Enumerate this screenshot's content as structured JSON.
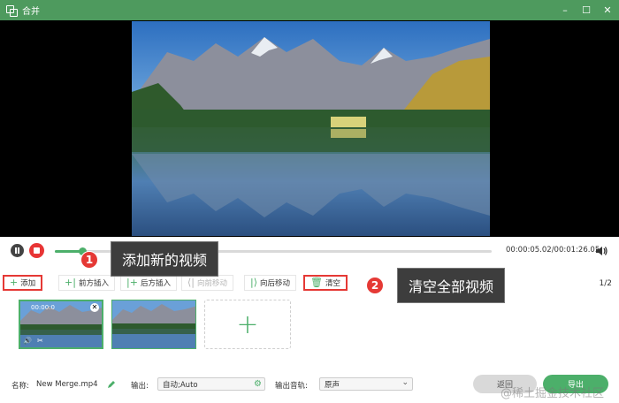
{
  "window": {
    "title": "合并"
  },
  "player": {
    "progress_fraction": 0.063,
    "time_readout": "00:00:05.02/00:01:26.05"
  },
  "toolbar": {
    "add_label": "添加",
    "insert_before_label": "前方插入",
    "insert_after_label": "后方插入",
    "move_forward_label": "向前移动",
    "move_backward_label": "向后移动",
    "clear_label": "清空",
    "page_count": "1/2"
  },
  "callouts": [
    {
      "number": "1",
      "text": "添加新的视频"
    },
    {
      "number": "2",
      "text": "清空全部视频"
    }
  ],
  "clips": [
    {
      "time": "00:00:0"
    }
  ],
  "footer": {
    "name_label": "名称:",
    "name_value": "New Merge.mp4",
    "output_label": "输出:",
    "output_value": "自动;Auto",
    "audio_label": "输出音轨:",
    "audio_value": "原声",
    "back_label": "返回",
    "export_label": "导出"
  },
  "watermark": "@稀土掘金技术社区",
  "colors": {
    "accent": "#4caf6a",
    "titlebar": "#4e9a5e",
    "highlight": "#e53935"
  }
}
